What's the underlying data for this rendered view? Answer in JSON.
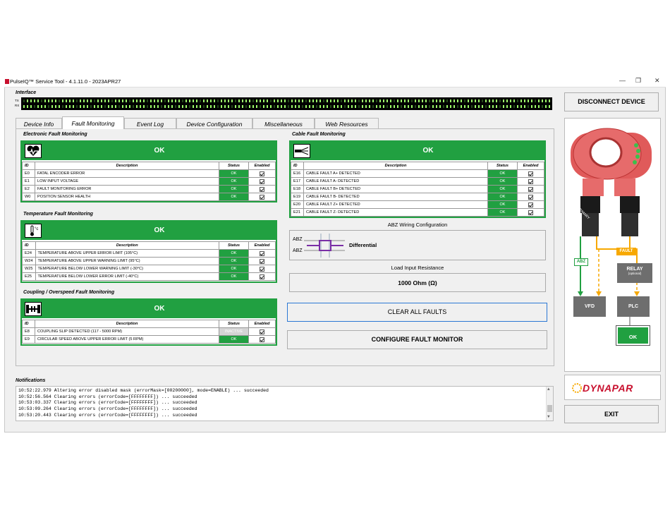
{
  "window": {
    "title": "PulseIQ™ Service Tool - 4.1.11.0 - 2023APR27"
  },
  "interface": {
    "label": "Interface",
    "tx_label": "TX",
    "rx_label": "RX"
  },
  "tabs": [
    {
      "label": "Device Info",
      "active": false
    },
    {
      "label": "Fault Monitoring",
      "active": true
    },
    {
      "label": "Event Log",
      "active": false
    },
    {
      "label": "Device Configuration",
      "active": false
    },
    {
      "label": "Miscellaneous",
      "active": false
    },
    {
      "label": "Web Resources",
      "active": false
    }
  ],
  "columns": {
    "id": "ID",
    "description": "Description",
    "status": "Status",
    "enabled": "Enabled"
  },
  "electronic": {
    "title": "Electronic Fault Monitoring",
    "status": "OK",
    "rows": [
      {
        "id": "E0",
        "desc": "FATAL ENCODER ERROR",
        "status": "OK",
        "enabled": true
      },
      {
        "id": "E1",
        "desc": "LOW INPUT VOLTAGE",
        "status": "OK",
        "enabled": true
      },
      {
        "id": "E2",
        "desc": "FAULT MONITORING ERROR",
        "status": "OK",
        "enabled": true
      },
      {
        "id": "W0",
        "desc": "POSITION SENSOR HEALTH",
        "status": "OK",
        "enabled": true
      }
    ]
  },
  "temperature": {
    "title": "Temperature Fault Monitoring",
    "status": "OK",
    "rows": [
      {
        "id": "E24",
        "desc": "TEMPERATURE ABOVE UPPER ERROR LIMIT (105°C)",
        "status": "OK",
        "enabled": true
      },
      {
        "id": "W24",
        "desc": "TEMPERATURE ABOVE UPPER WARNING LIMIT (95°C)",
        "status": "OK",
        "enabled": true
      },
      {
        "id": "W25",
        "desc": "TEMPERATURE BELOW LOWER WARNING LIMIT (-30°C)",
        "status": "OK",
        "enabled": true
      },
      {
        "id": "E25",
        "desc": "TEMPERATURE BELOW LOWER ERROR LIMIT (-40°C)",
        "status": "OK",
        "enabled": true
      }
    ]
  },
  "coupling": {
    "title": "Coupling / Overspeed Fault Monitoring",
    "status": "OK",
    "rows": [
      {
        "id": "E8",
        "desc": "COUPLING SLIP DETECTED (117 - 5000 RPM)",
        "status": "INACTIVE",
        "enabled": true
      },
      {
        "id": "E9",
        "desc": "CIRCULAR SPEED ABOVE UPPER ERROR LIMIT (5 RPM)",
        "status": "OK",
        "enabled": true
      }
    ]
  },
  "cable": {
    "title": "Cable Fault Monitoring",
    "status": "OK",
    "rows": [
      {
        "id": "E16",
        "desc": "CABLE FAULT A+ DETECTED",
        "status": "OK",
        "enabled": true
      },
      {
        "id": "E17",
        "desc": "CABLE FAULT A- DETECTED",
        "status": "OK",
        "enabled": true
      },
      {
        "id": "E18",
        "desc": "CABLE FAULT B+ DETECTED",
        "status": "OK",
        "enabled": true
      },
      {
        "id": "E19",
        "desc": "CABLE FAULT B- DETECTED",
        "status": "OK",
        "enabled": true
      },
      {
        "id": "E20",
        "desc": "CABLE FAULT Z+ DETECTED",
        "status": "OK",
        "enabled": true
      },
      {
        "id": "E21",
        "desc": "CABLE FAULT Z- DETECTED",
        "status": "OK",
        "enabled": true
      }
    ]
  },
  "abz": {
    "title": "ABZ Wiring Configuration",
    "label_top": "ABZ",
    "label_bottom": "ABZ",
    "value": "Differential"
  },
  "resistance": {
    "title": "Load Input Resistance",
    "value": "1000 Ohm (Ω)"
  },
  "buttons": {
    "clear_all": "CLEAR ALL FAULTS",
    "configure": "CONFIGURE FAULT MONITOR",
    "disconnect": "DISCONNECT DEVICE",
    "exit": "EXIT"
  },
  "diagram": {
    "abz": "ABZ",
    "fault": "FAULT",
    "relay": "RELAY",
    "relay_sub": "(optional)",
    "vfd": "VFD",
    "plc": "PLC",
    "ok": "OK",
    "primary": "PRIMARY"
  },
  "brand": {
    "name": "DYNAPAR"
  },
  "notifications": {
    "label": "Notifications",
    "lines": [
      "10:52:22.979 Altering error disabled mask (errorMask=[00200000], mode=ENABLE) ... succeeded",
      "10:52:56.564 Clearing errors (errorCode=[FFFFFFFF]) ... succeeded",
      "10:53:03.337 Clearing errors (errorCode=[FFFFFFFF]) ... succeeded",
      "10:53:09.264 Clearing errors (errorCode=[FFFFFFFF]) ... succeeded",
      "10:53:20.443 Clearing errors (errorCode=[FFFFFFFF]) ... succeeded"
    ]
  },
  "colors": {
    "green": "#21a041",
    "brand_red": "#c8102e",
    "fault_orange": "#f7a800",
    "inactive": "#d4d4d4"
  }
}
